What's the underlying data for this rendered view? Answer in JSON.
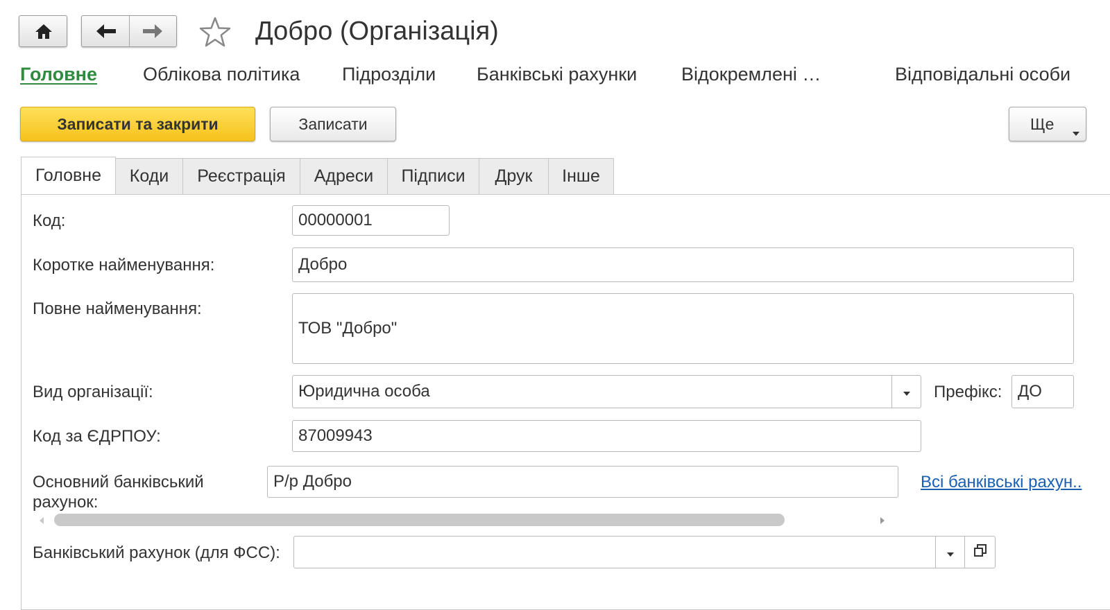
{
  "window": {
    "title": "Добро (Організація)"
  },
  "icons": {
    "home": "home-icon",
    "back": "arrow-left-icon",
    "forward": "arrow-right-icon",
    "favorite": "star-icon",
    "dropdown": "chevron-down-icon",
    "open": "open-form-icon"
  },
  "colors": {
    "accent_green": "#2e8b3f",
    "primary_button": "#f6c21c",
    "link": "#1a5fb4"
  },
  "sections": [
    "Головне",
    "Облікова політика",
    "Підрозділи",
    "Банківські рахунки",
    "Відокремлені …",
    "Відповідальні особи"
  ],
  "toolbar": {
    "save_close": "Записати та закрити",
    "save": "Записати",
    "more": "Ще"
  },
  "tabs": [
    "Головне",
    "Коди",
    "Реєстрація",
    "Адреси",
    "Підписи",
    "Друк",
    "Інше"
  ],
  "form": {
    "code_label": "Код:",
    "code_value": "00000001",
    "short_name_label": "Коротке найменування:",
    "short_name_value": "Добро",
    "full_name_label": "Повне найменування:",
    "full_name_value": "ТОВ \"Добро\"",
    "org_type_label": "Вид організації:",
    "org_type_value": "Юридична особа",
    "prefix_label": "Префікс:",
    "prefix_value": "ДО",
    "edrpou_label": "Код за ЄДРПОУ:",
    "edrpou_value": "87009943",
    "main_bank_label_1": "Основний банківський",
    "main_bank_label_2": "рахунок:",
    "main_bank_value": "Р/р Добро",
    "all_bank_link": "Всі банківські рахун..",
    "fss_bank_label": "Банківський рахунок (для ФСС):",
    "fss_bank_value": ""
  }
}
